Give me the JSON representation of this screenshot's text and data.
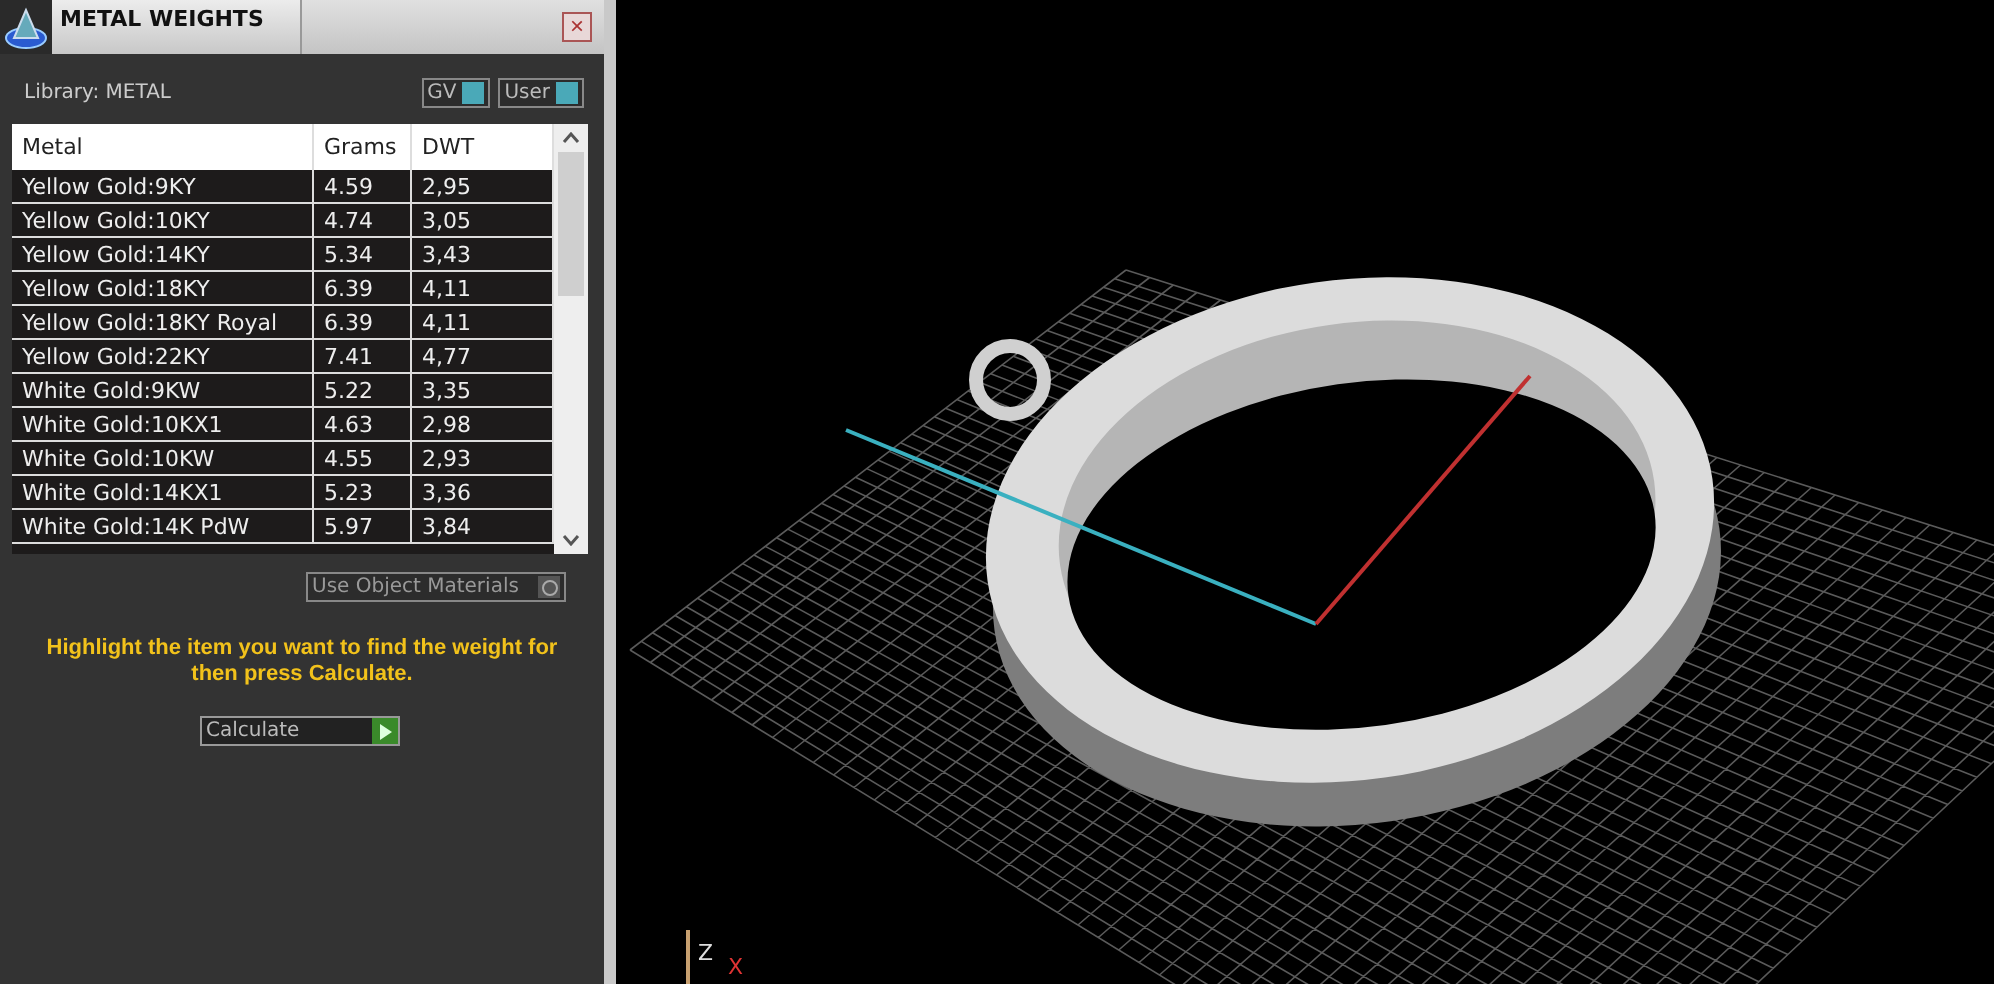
{
  "panel": {
    "title": "METAL WEIGHTS",
    "close": "×",
    "library": "Library: METAL",
    "toggles": [
      {
        "label": "GV",
        "on": true
      },
      {
        "label": "User",
        "on": true
      }
    ],
    "table": {
      "columns": [
        "Metal",
        "Grams",
        "DWT"
      ],
      "rows": [
        {
          "cells": [
            "Yellow Gold:9KY",
            "4.59",
            "2,95"
          ],
          "selected": false
        },
        {
          "cells": [
            "Yellow Gold:10KY",
            "4.74",
            "3,05"
          ],
          "selected": false
        },
        {
          "cells": [
            "Yellow Gold:14KY",
            "5.34",
            "3,43"
          ],
          "selected": false
        },
        {
          "cells": [
            "Yellow Gold:18KY",
            "6.39",
            "4,11"
          ],
          "selected": false
        },
        {
          "cells": [
            "Yellow Gold:18KY Royal",
            "6.39",
            "4,11"
          ],
          "selected": false
        },
        {
          "cells": [
            "Yellow Gold:22KY",
            "7.41",
            "4,77"
          ],
          "selected": false
        },
        {
          "cells": [
            "White Gold:9KW",
            "5.22",
            "3,35"
          ],
          "selected": false
        },
        {
          "cells": [
            "White Gold:10KX1",
            "4.63",
            "2,98"
          ],
          "selected": false
        },
        {
          "cells": [
            "White Gold:10KW",
            "4.55",
            "2,93"
          ],
          "selected": false
        },
        {
          "cells": [
            "White Gold:14KX1",
            "5.23",
            "3,36"
          ],
          "selected": false
        },
        {
          "cells": [
            "White Gold:14K PdW",
            "5.97",
            "3,84"
          ],
          "selected": false
        }
      ]
    },
    "object_materials": {
      "label": "Use Object Materials",
      "on": false
    },
    "hint": "Highlight the item you want to find the weight for then press Calculate.",
    "calculate": "Calculate"
  },
  "viewport": {
    "axis_labels": [
      "Z",
      "X"
    ]
  }
}
